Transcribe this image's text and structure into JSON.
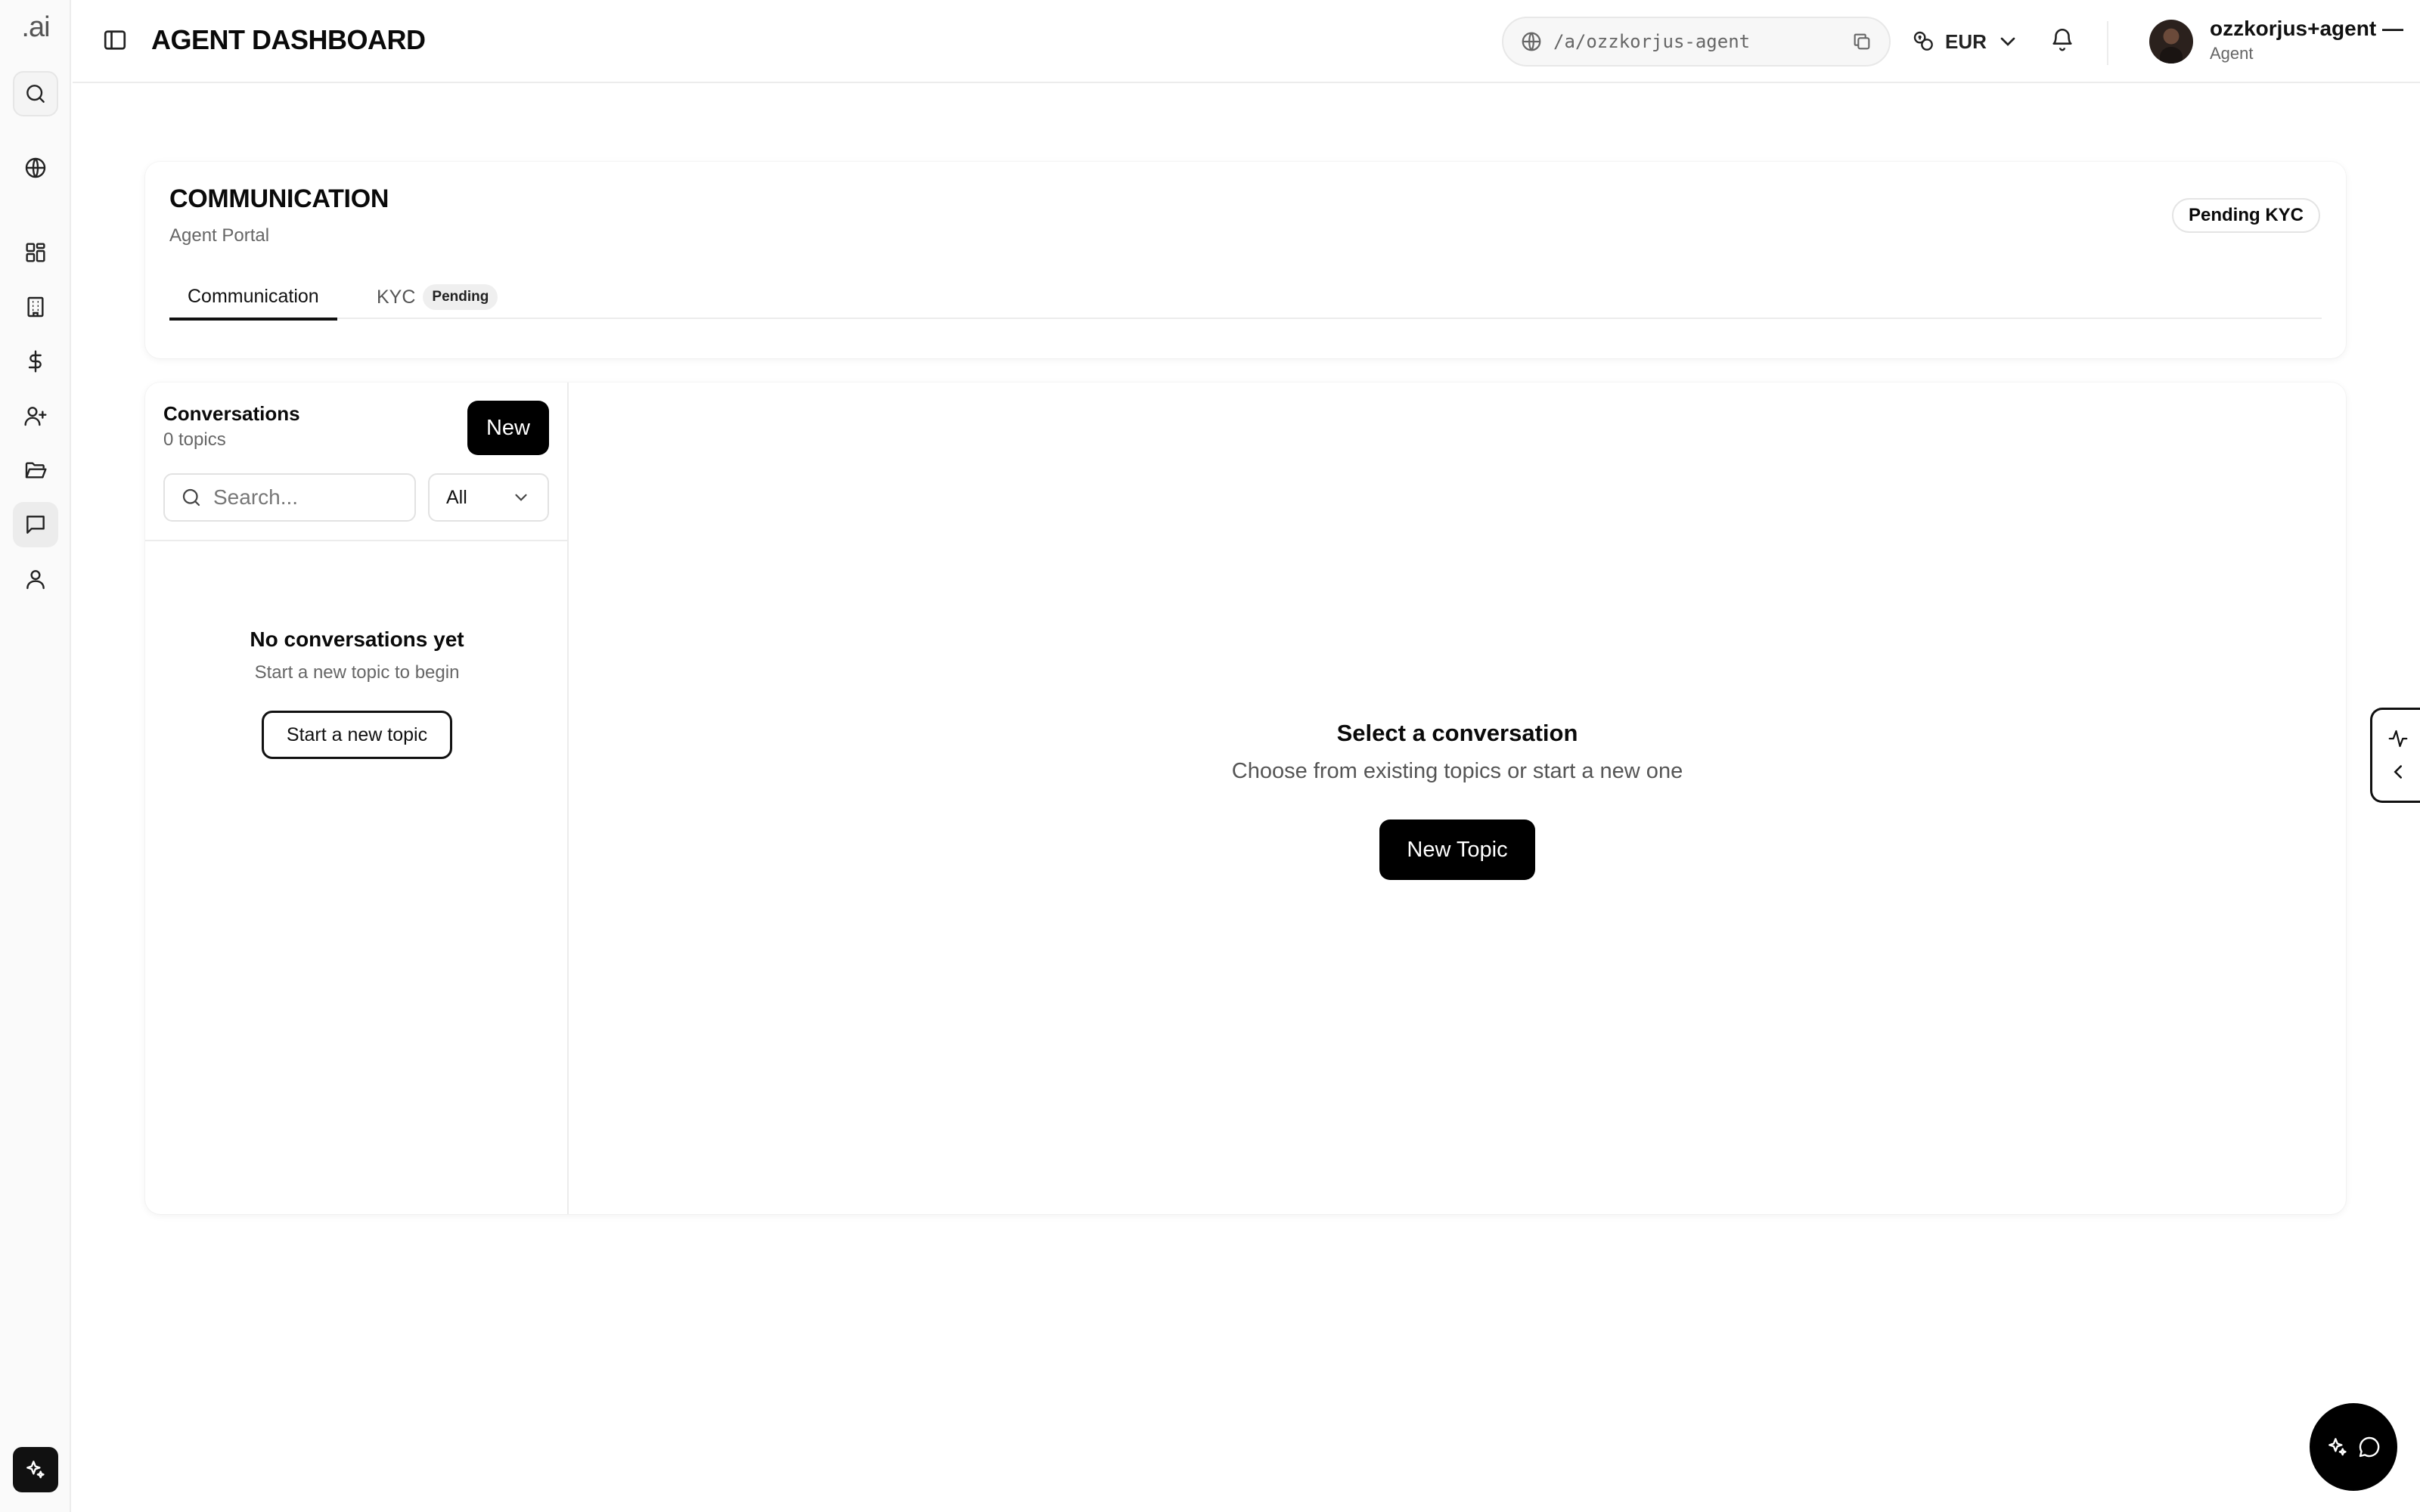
{
  "app": {
    "logo_text": ".ai"
  },
  "rail": {
    "items": [
      {
        "icon": "search-icon"
      },
      {
        "icon": "globe-icon"
      },
      {
        "icon": "dashboard-icon"
      },
      {
        "icon": "building-icon"
      },
      {
        "icon": "dollar-icon"
      },
      {
        "icon": "user-plus-icon"
      },
      {
        "icon": "folder-open-icon"
      },
      {
        "icon": "message-square-icon",
        "active": true
      },
      {
        "icon": "user-icon"
      },
      {
        "icon": "sparkles-icon"
      }
    ]
  },
  "header": {
    "title": "AGENT DASHBOARD",
    "url_path": "/a/ozzkorjus-agent",
    "currency": "EUR",
    "user_name": "ozzkorjus+agent —",
    "user_role": "Agent"
  },
  "page": {
    "title": "COMMUNICATION",
    "subtitle": "Agent Portal",
    "status_badge": "Pending KYC",
    "tabs": [
      {
        "label": "Communication",
        "active": true
      },
      {
        "label": "KYC",
        "badge": "Pending",
        "active": false
      }
    ]
  },
  "conversations": {
    "title": "Conversations",
    "count_label": "0 topics",
    "new_button": "New",
    "search_placeholder": "Search...",
    "filter_value": "All",
    "empty_title": "No conversations yet",
    "empty_subtitle": "Start a new topic to begin",
    "start_button": "Start a new topic"
  },
  "detail": {
    "title": "Select a conversation",
    "subtitle": "Choose from existing topics or start a new one",
    "new_topic_button": "New Topic"
  },
  "colors": {
    "primary": "#000000",
    "rail_bg": "#fafafa",
    "border": "#ececec"
  }
}
